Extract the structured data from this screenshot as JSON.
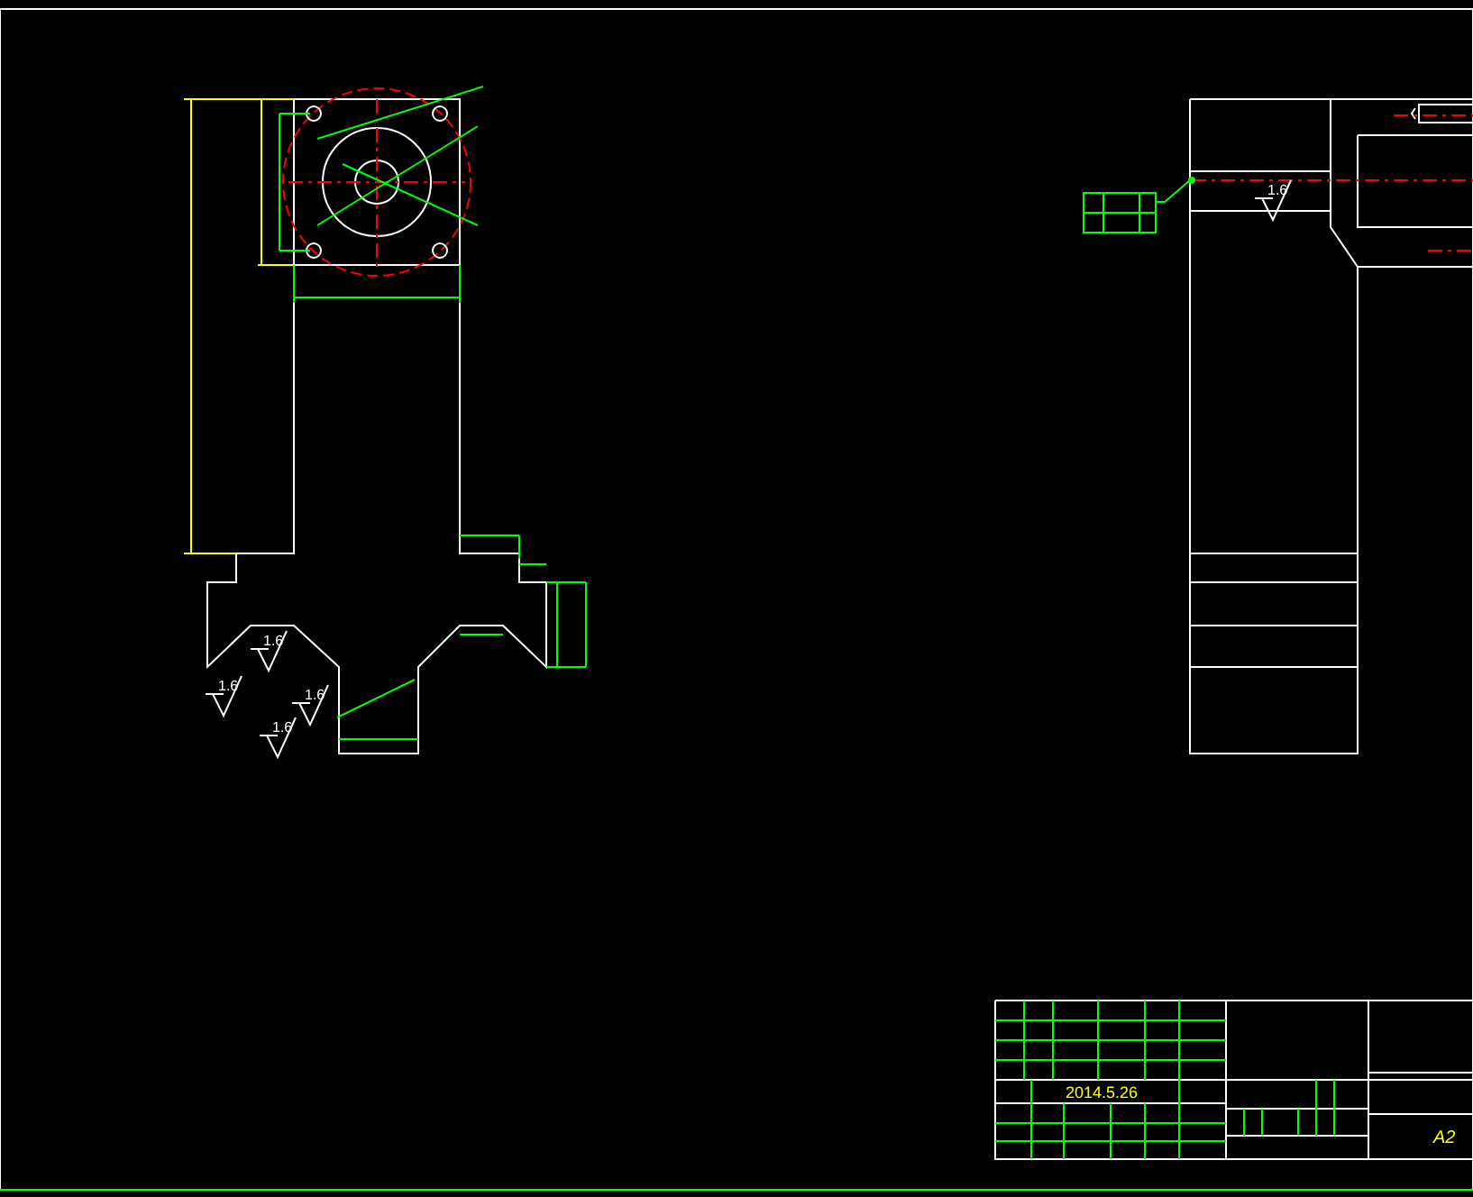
{
  "drawing": {
    "front_view": {
      "roughness_marks": [
        "1.6",
        "1.6",
        "1.6",
        "1.6"
      ]
    },
    "side_view": {
      "roughness_mark": "1.6"
    }
  },
  "title_block": {
    "date": "2014.5.26",
    "sheet_size": "A2"
  }
}
